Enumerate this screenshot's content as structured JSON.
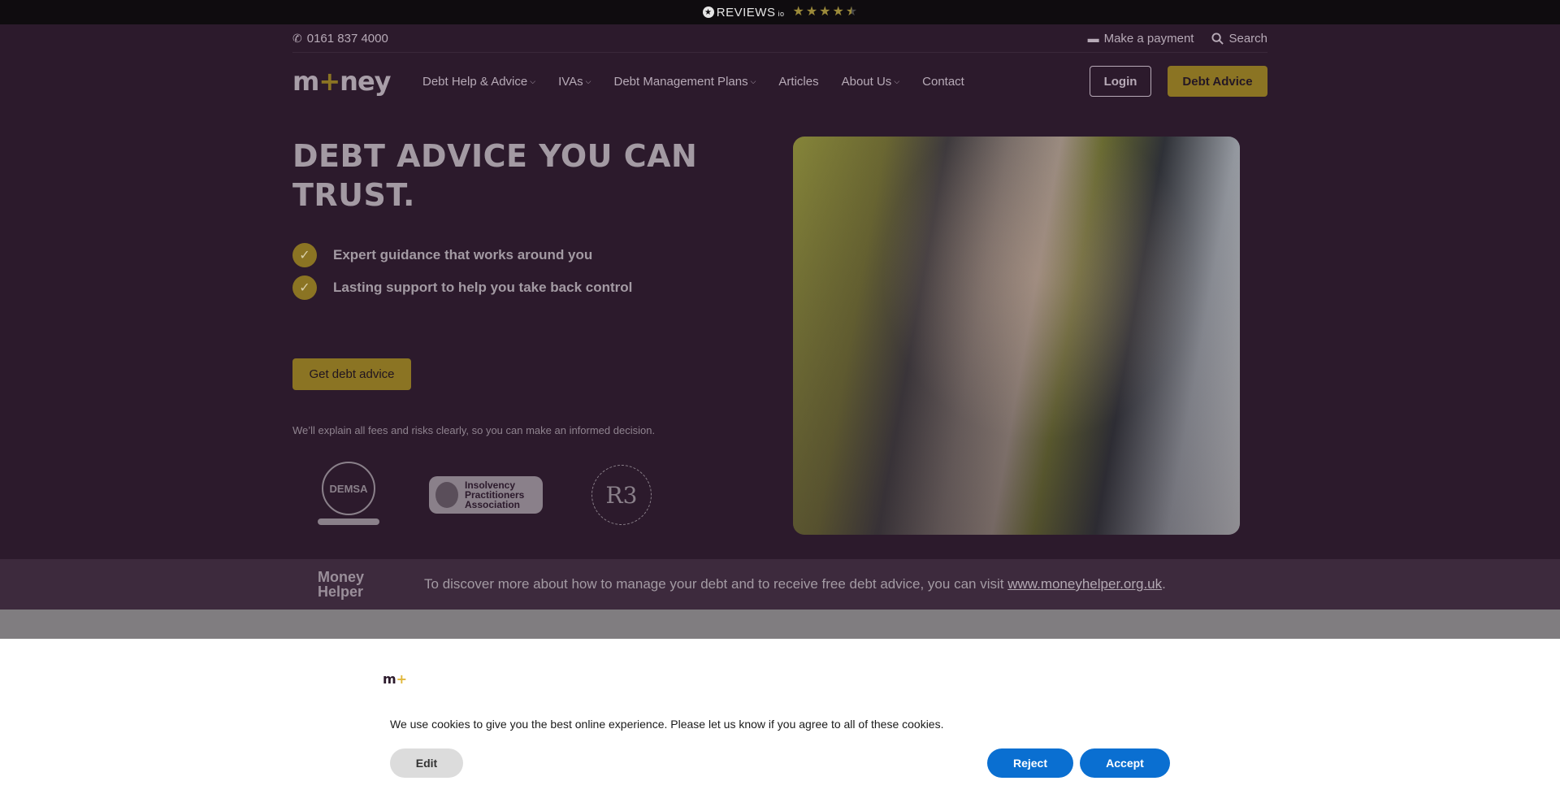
{
  "topbar": {
    "reviews_logo": "REVIEWS",
    "reviews_suffix": "io",
    "rating_stars": 4.5
  },
  "utility": {
    "phone": "0161 837 4000",
    "payment": "Make a payment",
    "search": "Search"
  },
  "nav": {
    "logo_left": "m",
    "logo_plus": "+",
    "logo_right": "ney",
    "menu": [
      {
        "label": "Debt Help & Advice",
        "has_caret": true
      },
      {
        "label": "IVAs",
        "has_caret": true
      },
      {
        "label": "Debt Management Plans",
        "has_caret": true
      },
      {
        "label": "Articles",
        "has_caret": false
      },
      {
        "label": "About Us",
        "has_caret": true
      },
      {
        "label": "Contact",
        "has_caret": false
      }
    ],
    "login": "Login",
    "debt_advice": "Debt Advice"
  },
  "hero": {
    "title": "DEBT ADVICE YOU CAN TRUST.",
    "bullets": [
      "Expert guidance that works around you",
      "Lasting support to help you take back control"
    ],
    "cta": "Get debt advice",
    "disclaimer": "We’ll explain all fees and risks clearly, so you can make an informed decision.",
    "badges": {
      "demsa": "DEMSA",
      "ipa_line1": "Insolvency",
      "ipa_line2": "Practitioners",
      "ipa_line3": "Association",
      "r3": "R3"
    }
  },
  "helper": {
    "logo_line1": "Money",
    "logo_line2": "Helper",
    "text": "To discover more about how to manage your debt and to receive free debt advice, you can visit ",
    "link": "www.moneyhelper.org.uk",
    "end": "."
  },
  "cookie": {
    "logo_m": "m",
    "logo_plus": "+",
    "text": "We use cookies to give you the best online experience. Please let us know if you agree to all of these cookies.",
    "edit": "Edit",
    "reject": "Reject",
    "accept": "Accept"
  },
  "colors": {
    "accent_gold": "#8b7423",
    "background_purple": "#2c1a2c",
    "cookie_button_blue": "#0a6fd1"
  }
}
